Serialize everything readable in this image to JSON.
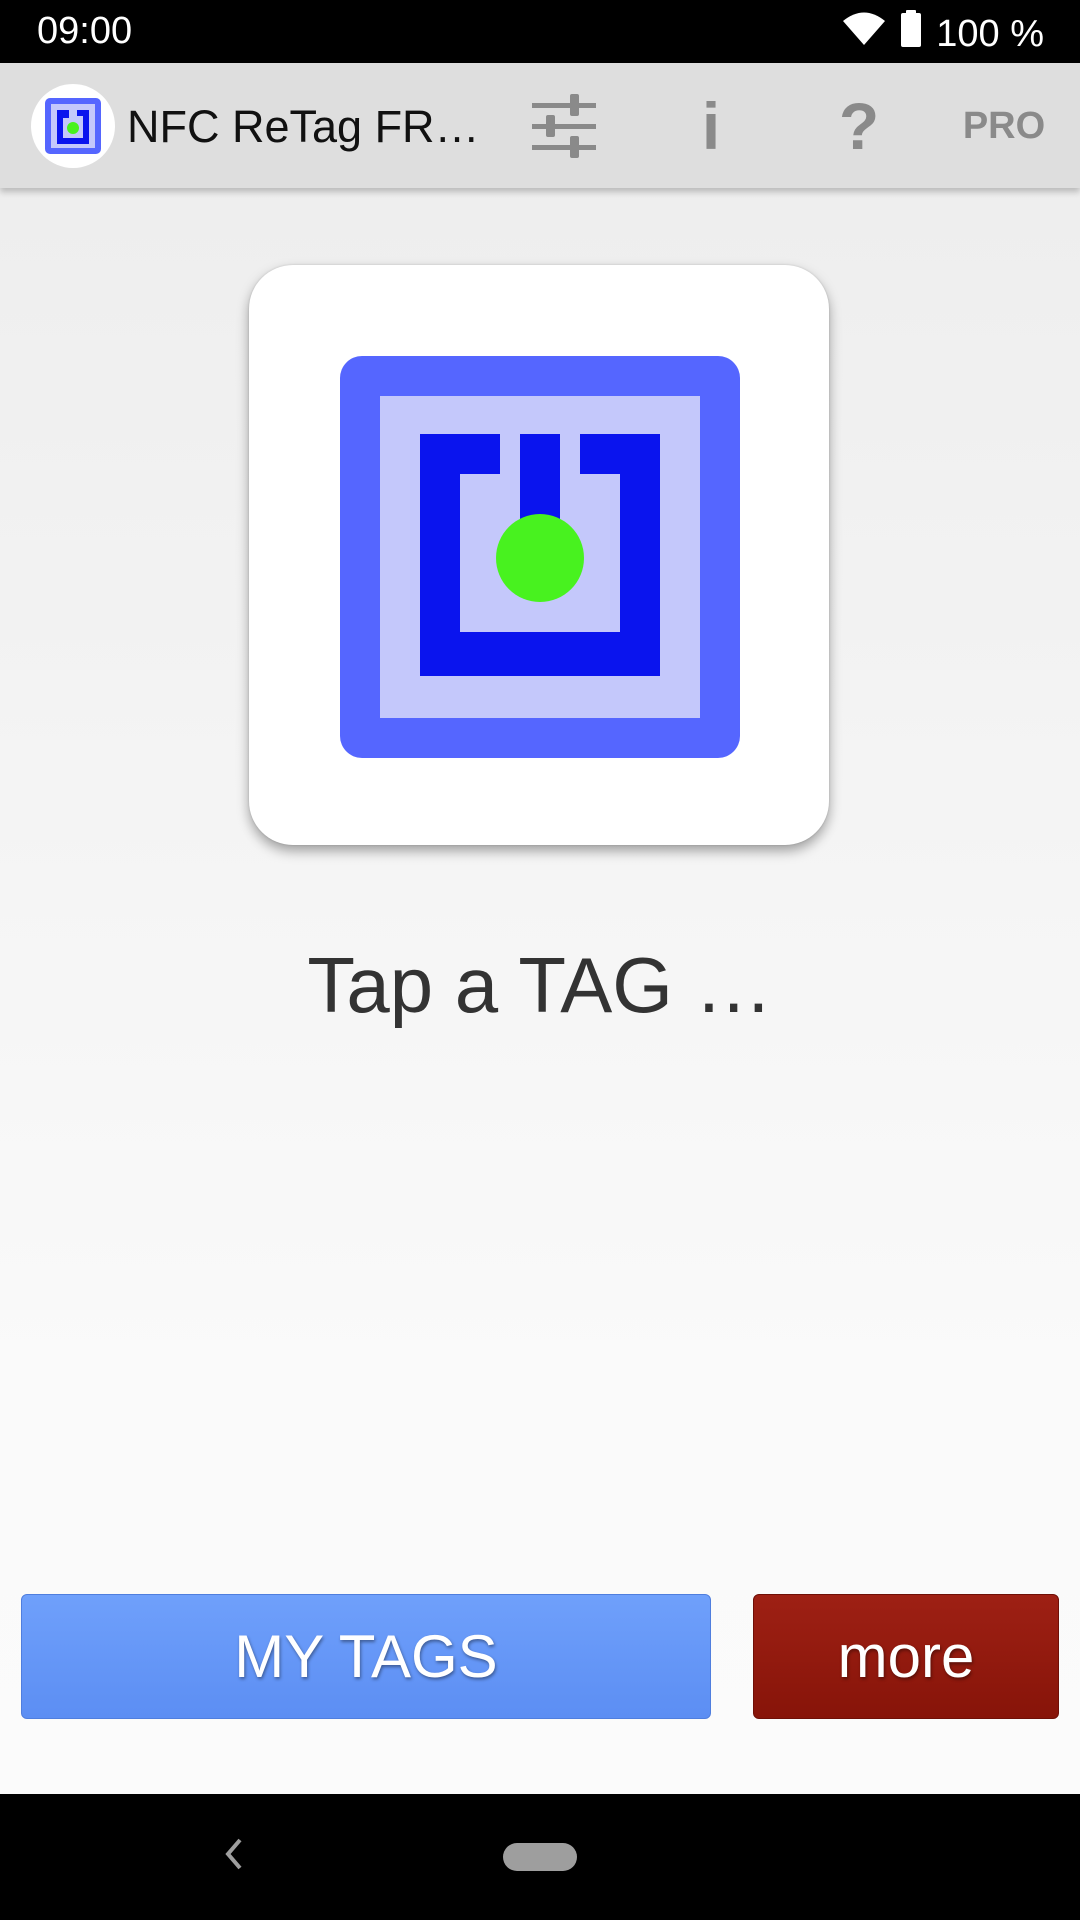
{
  "status_bar": {
    "time": "09:00",
    "battery": "100 %"
  },
  "toolbar": {
    "title": "NFC ReTag FR…",
    "pro_label": "PRO",
    "info_glyph": "i",
    "help_glyph": "?",
    "icons": [
      "app-logo-icon",
      "settings-sliders-icon",
      "info-icon",
      "help-icon"
    ]
  },
  "main": {
    "tap_prompt": "Tap a TAG …",
    "tag_icon": "nfc-tag-icon"
  },
  "buttons": {
    "my_tags": "MY TAGS",
    "more": "more"
  },
  "nav_bar": {
    "icons": [
      "back-icon",
      "home-pill-icon"
    ]
  },
  "colors": {
    "accent_blue": "#6c9cf9",
    "more_red": "#931a0f",
    "tag_outer": "#5566ff",
    "tag_inner": "#0a14ee",
    "tag_dot": "#48f21f"
  }
}
